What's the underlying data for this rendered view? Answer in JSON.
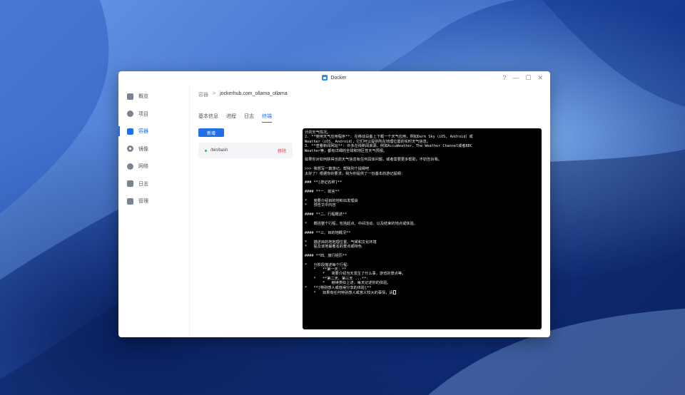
{
  "window": {
    "title": "Docker",
    "controls": [
      "?",
      "—",
      "☐",
      "✕"
    ]
  },
  "sidebar": {
    "items": [
      {
        "label": "概览",
        "icon": "overview-icon"
      },
      {
        "label": "项目",
        "icon": "project-icon"
      },
      {
        "label": "容器",
        "icon": "container-icon",
        "active": true
      },
      {
        "label": "镜像",
        "icon": "image-icon"
      },
      {
        "label": "网络",
        "icon": "network-icon"
      },
      {
        "label": "日志",
        "icon": "log-icon"
      },
      {
        "label": "管理",
        "icon": "manage-icon"
      }
    ]
  },
  "breadcrumb": {
    "parent": "容器",
    "separator": ">",
    "current": "jockerhub.com_ollama_ollama"
  },
  "tabs": [
    {
      "label": "基本信息"
    },
    {
      "label": "进程"
    },
    {
      "label": "日志"
    },
    {
      "label": "终端",
      "active": true
    }
  ],
  "toolbar": {
    "add_label": "新增"
  },
  "session": {
    "name": "/bin/bash",
    "remove_label": "移除"
  },
  "terminal": {
    "lines": [
      "计的天气情况。",
      "2. **使用天气应用程序**: 在移动设备上下载一个天气应用，例如Dark Sky（iOS, Android）或",
      "Weather（iOS, Android），它们可以提供所在地理位置的实时天气信息。",
      "3. **查看新闻网站**: 许多在线新闻来源，例如AccuWeather、The Weather Channel或者BBC",
      "Weather等，都有详细的全球和地区性天气预报。",
      "",
      "如果你对如何获得当前天气信息有任何具体问题，或者需要更多帮助，不妨告诉我。",
      "",
      ">>> 我想写一篇游记，帮我列个提纲吧",
      "太好了！根据你的要求，我为你提供了一份基本的游记提纲：",
      "",
      "### **[游记名称]**",
      "",
      "#### **一、前言**",
      "",
      "*   简要介绍目的地和出发理由",
      "*   预告文中内容",
      "",
      "#### **二、行程概述**",
      "",
      "*   概括整个行程，包括起点、中间活动、以及结束的地点或体验。",
      "",
      "#### **三、目的地概况**",
      "",
      "*   描述目的地地理位置、气候和文化环境",
      "*   提及该地最著名的景点或特色",
      "",
      "#### **四、旅行经历**",
      "",
      "*   分阶段描述每个行程：",
      "    *   **第一天：**",
      "        *   简要介绍当天发生了什么事，游览的景点等。",
      "    *   **第二天、第三天 ...**:",
      "        *   继续类似上述，每天记述你的体验。",
      "*   **[特别感人或值得分享的体验]**",
      "    *   如果有任何特别感人或意义较大的事情，请"
    ]
  },
  "colors": {
    "accent": "#1f6fe5",
    "terminal_bg": "#000000",
    "terminal_fg": "#e8e8e8",
    "remove": "#e4393c",
    "status_running": "#1fbf5f"
  }
}
